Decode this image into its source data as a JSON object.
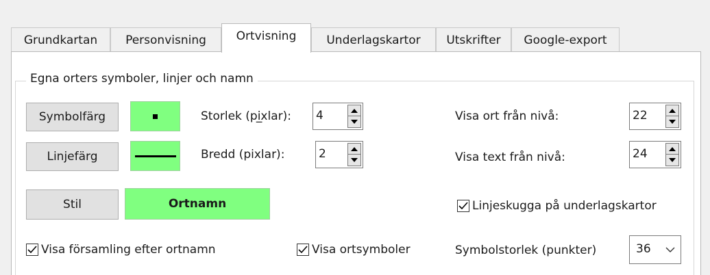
{
  "tabs": [
    {
      "label": "Grundkartan"
    },
    {
      "label": "Personvisning"
    },
    {
      "label": "Ortvisning",
      "active": true
    },
    {
      "label": "Underlagskartor"
    },
    {
      "label": "Utskrifter"
    },
    {
      "label": "Google-export"
    }
  ],
  "group": {
    "title": "Egna orters symboler, linjer och namn"
  },
  "symbol": {
    "button_label": "Symbolfärg",
    "size_label": "Storlek (pi̲xlar):",
    "size_value": "4"
  },
  "line": {
    "button_label": "Linjefärg",
    "width_label": "Bredd (pixlar):",
    "width_value": "2"
  },
  "style": {
    "button_label": "Stil",
    "ortnamn_label": "Ortnamn"
  },
  "levels": {
    "show_place_label": "Visa ort från nivå:",
    "show_place_value": "22",
    "show_text_label": "Visa text från nivå:",
    "show_text_value": "24"
  },
  "checkboxes": {
    "line_shadow": "Linjeskugga på underlagskartor",
    "show_parish": "Visa församling efter ortnamn",
    "show_symbols": "Visa ortsymboler"
  },
  "symbol_size": {
    "label": "Symbolstorlek (punkter)",
    "value": "36"
  },
  "colors": {
    "swatch": "#80ff80",
    "button_bg": "#e1e1e1",
    "panel_bg": "#ffffff"
  }
}
